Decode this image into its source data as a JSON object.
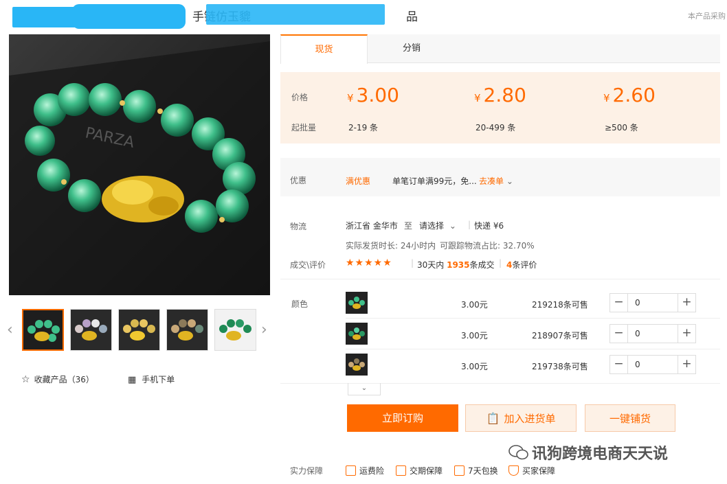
{
  "title": {
    "visible_text": "手链仿玉貔",
    "suffix": "品"
  },
  "top_right_link": "本产品采购",
  "tabs": [
    {
      "label": "现货"
    },
    {
      "label": "分销"
    }
  ],
  "price_panel": {
    "price_label": "价格",
    "moq_label": "起批量",
    "currency": "¥",
    "tiers": [
      {
        "price": "3.00",
        "range": "2-19 条"
      },
      {
        "price": "2.80",
        "range": "20-499 条"
      },
      {
        "price": "2.60",
        "range": "≥500 条"
      }
    ]
  },
  "promo": {
    "label": "优惠",
    "tag": "满优惠",
    "text": "单笔订单满99元，免...",
    "link": "去凑单"
  },
  "logistics": {
    "label": "物流",
    "origin": "浙江省 金华市",
    "to": "至",
    "dest_select": "请选择",
    "express": "快递 ¥6",
    "ship_time": "实际发货时长: 24小时内",
    "track_rate": "可跟踪物流占比: 32.70%"
  },
  "reviews": {
    "label": "成交\\评价",
    "stars": "★★★★★",
    "rating": 4.5,
    "sales_prefix": "30天内",
    "sales_count": "1935",
    "sales_suffix": "条成交",
    "review_count": "4",
    "review_suffix": "条评价"
  },
  "variants": {
    "label": "颜色",
    "rows": [
      {
        "price": "3.00元",
        "stock": "219218条可售",
        "qty": "0"
      },
      {
        "price": "3.00元",
        "stock": "218907条可售",
        "qty": "0"
      },
      {
        "price": "3.00元",
        "stock": "219738条可售",
        "qty": "0"
      }
    ]
  },
  "buttons": {
    "order": "立即订购",
    "cart": "加入进货单",
    "distribute": "一键铺货"
  },
  "favorites": {
    "label": "收藏产品（36）"
  },
  "mobile_order": "手机下单",
  "guarantee": {
    "label": "实力保障",
    "items": [
      "运费险",
      "交期保障",
      "7天包换",
      "买家保障"
    ]
  },
  "watermark": "讯狗跨境电商天天说",
  "colors": {
    "accent": "#ff6a00",
    "price_bg": "#fdf1e6",
    "redaction": "#29b6f6"
  }
}
